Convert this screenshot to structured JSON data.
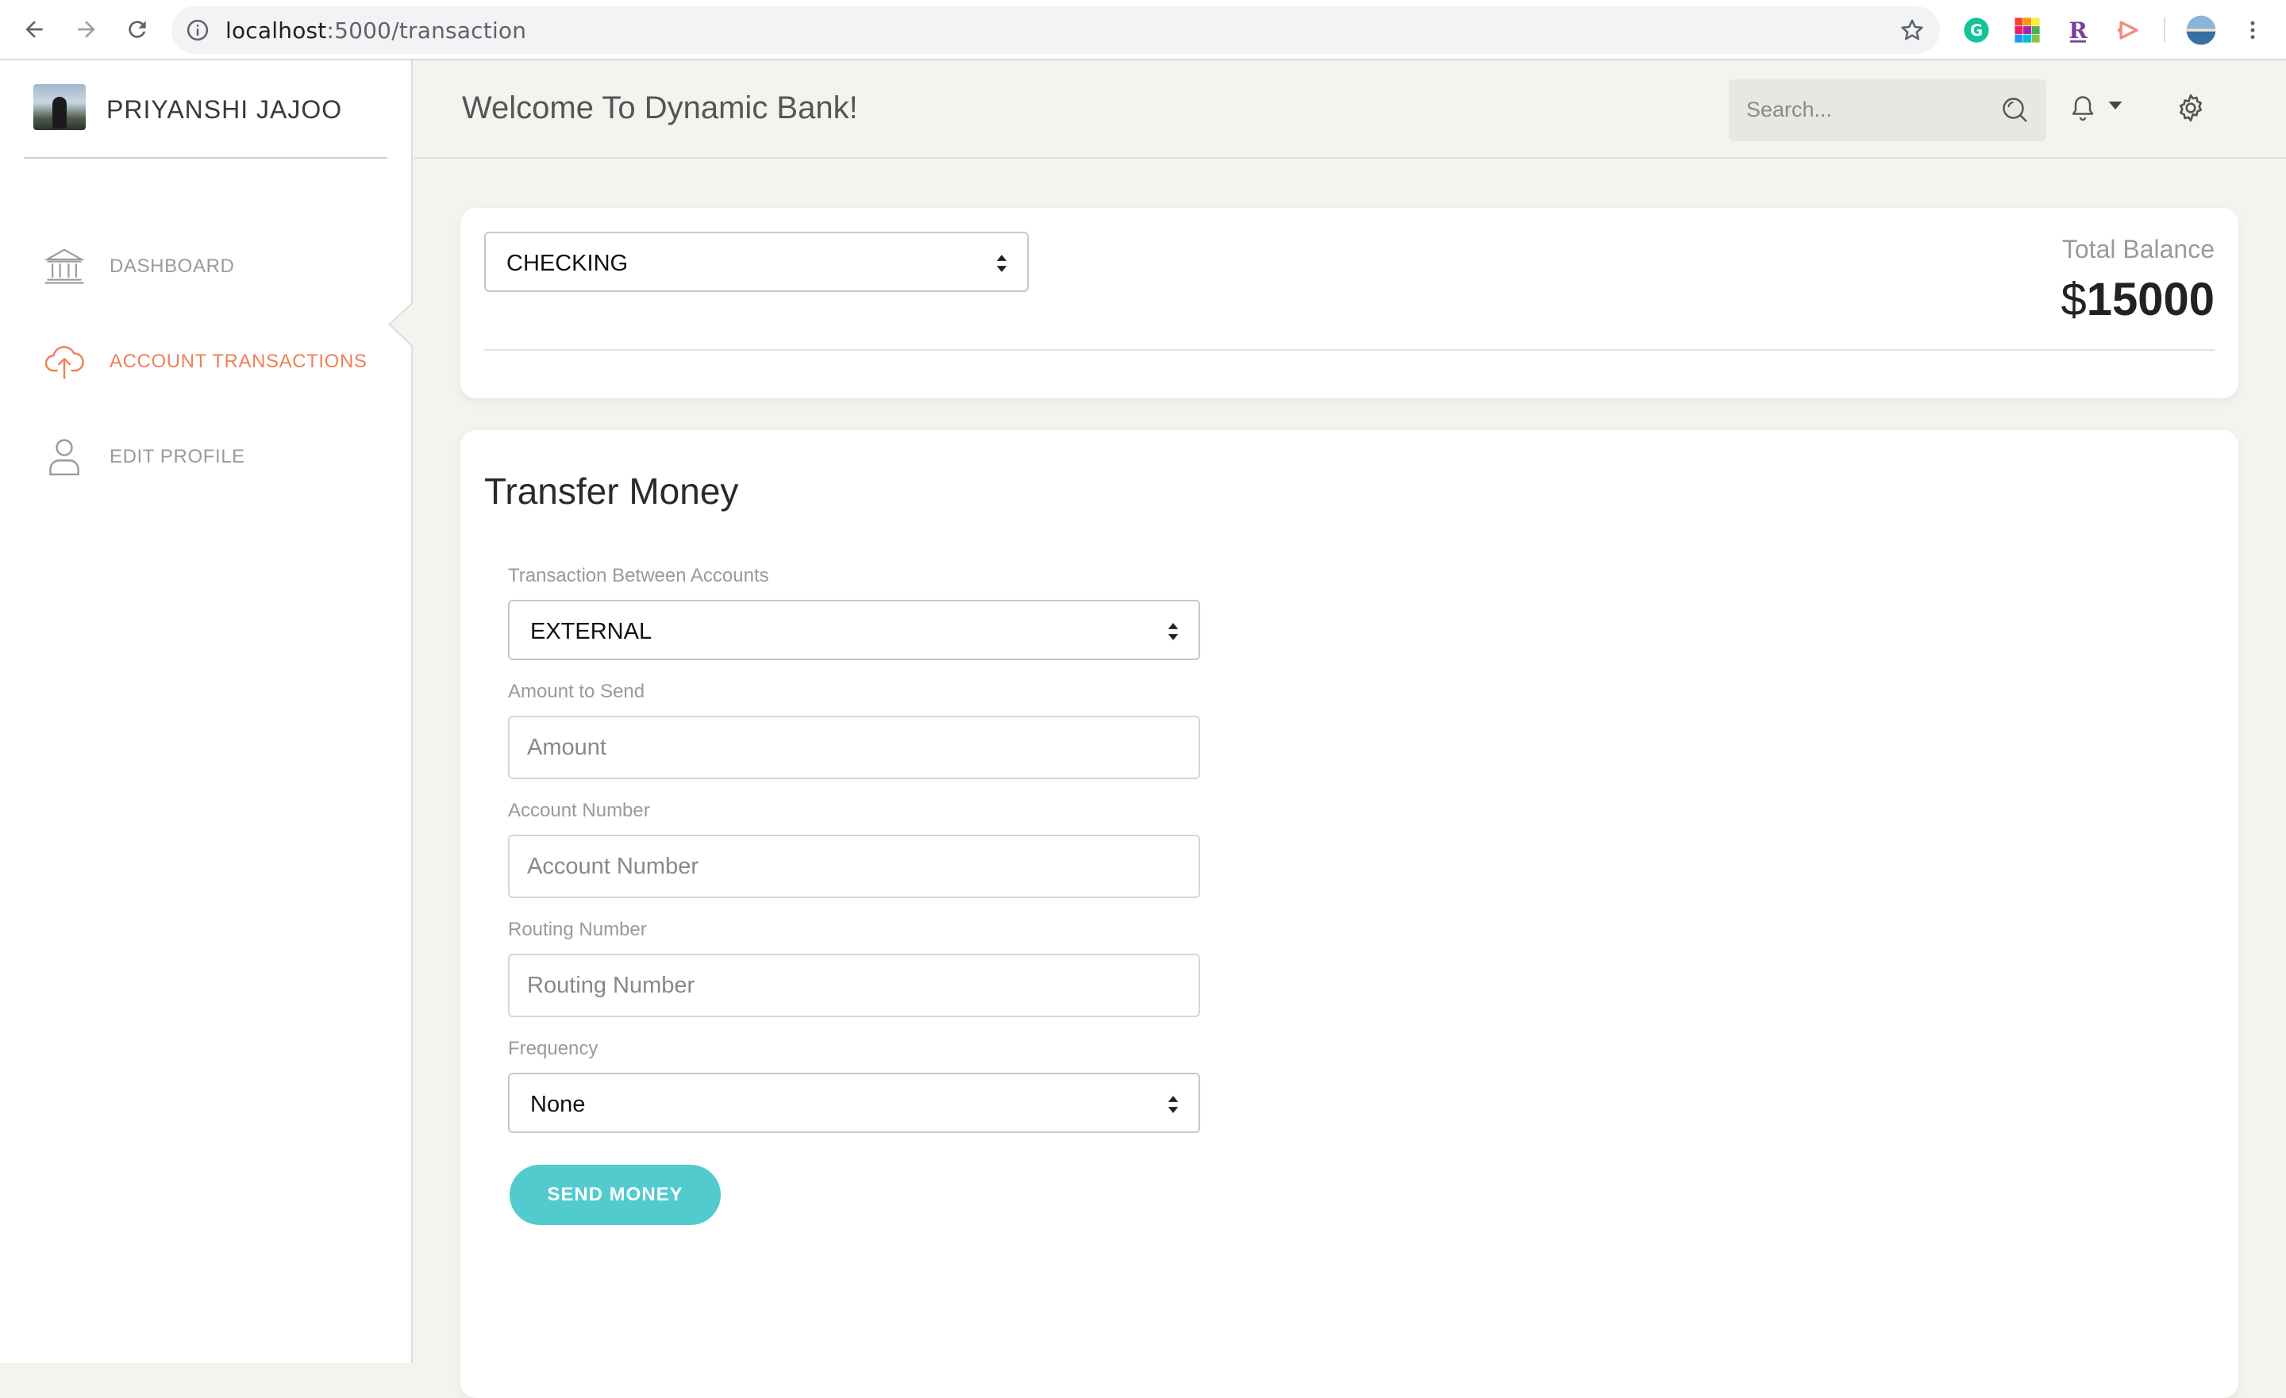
{
  "browser": {
    "url_host": "localhost",
    "url_path": ":5000/transaction"
  },
  "sidebar": {
    "user_name": "PRIYANSHI JAJOO",
    "items": [
      {
        "label": "DASHBOARD",
        "icon": "bank-icon",
        "active": false
      },
      {
        "label": "ACCOUNT TRANSACTIONS",
        "icon": "cloud-upload-icon",
        "active": true
      },
      {
        "label": "EDIT PROFILE",
        "icon": "user-icon",
        "active": false
      }
    ]
  },
  "topbar": {
    "title": "Welcome To Dynamic Bank!",
    "search_placeholder": "Search..."
  },
  "account_card": {
    "selected_account": "CHECKING",
    "balance_label": "Total Balance",
    "currency": "$",
    "balance_amount": "15000"
  },
  "transfer": {
    "heading": "Transfer Money",
    "transaction_label": "Transaction Between Accounts",
    "transaction_value": "EXTERNAL",
    "amount_label": "Amount to Send",
    "amount_placeholder": "Amount",
    "account_label": "Account Number",
    "account_placeholder": "Account Number",
    "routing_label": "Routing Number",
    "routing_placeholder": "Routing Number",
    "frequency_label": "Frequency",
    "frequency_value": "None",
    "send_button": "SEND MONEY"
  },
  "colors": {
    "accent": "#ef8157",
    "button": "#51cbce",
    "background": "#f4f3ef"
  }
}
